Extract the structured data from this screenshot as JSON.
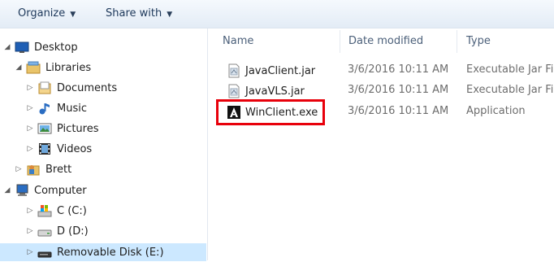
{
  "toolbar": {
    "organize_label": "Organize",
    "share_label": "Share with"
  },
  "nav": {
    "items": [
      {
        "label": "Desktop",
        "icon": "desktop-icon",
        "expander": "expanded"
      },
      {
        "label": "Libraries",
        "icon": "libraries-icon",
        "expander": "expanded"
      },
      {
        "label": "Documents",
        "icon": "documents-icon",
        "expander": "collapsed"
      },
      {
        "label": "Music",
        "icon": "music-icon",
        "expander": "collapsed"
      },
      {
        "label": "Pictures",
        "icon": "pictures-icon",
        "expander": "collapsed"
      },
      {
        "label": "Videos",
        "icon": "videos-icon",
        "expander": "collapsed"
      },
      {
        "label": "Brett",
        "icon": "user-folder-icon",
        "expander": "collapsed"
      },
      {
        "label": "Computer",
        "icon": "computer-icon",
        "expander": "expanded"
      },
      {
        "label": "C (C:)",
        "icon": "system-drive-icon",
        "expander": "collapsed"
      },
      {
        "label": "D (D:)",
        "icon": "drive-icon",
        "expander": "collapsed"
      },
      {
        "label": "Removable Disk (E:)",
        "icon": "removable-disk-icon",
        "expander": "collapsed",
        "selected": true
      }
    ]
  },
  "columns": {
    "name": "Name",
    "date": "Date modified",
    "type": "Type"
  },
  "files": [
    {
      "name": "JavaClient.jar",
      "date": "3/6/2016 10:11 AM",
      "type": "Executable Jar Fil",
      "icon": "jar-file-icon"
    },
    {
      "name": "JavaVLS.jar",
      "date": "3/6/2016 10:11 AM",
      "type": "Executable Jar Fil",
      "icon": "jar-file-icon"
    },
    {
      "name": "WinClient.exe",
      "date": "3/6/2016 10:11 AM",
      "type": "Application",
      "icon": "winclient-app-icon",
      "highlighted": true
    }
  ],
  "colors": {
    "highlight_border": "#e8000b",
    "selected_bg": "#cce8ff",
    "toolbar_bg": "#e3ecf6"
  }
}
